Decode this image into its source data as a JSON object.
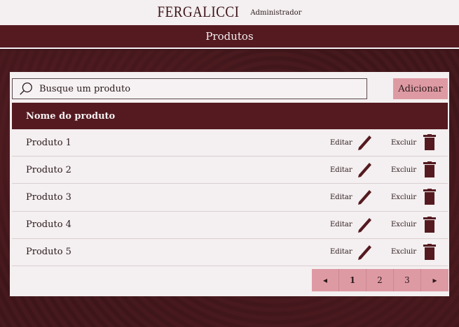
{
  "header": {
    "brand": "FERGALICCI",
    "role": "Administrador"
  },
  "title": "Produtos",
  "search": {
    "placeholder": "Busque um produto",
    "icon": "search-icon"
  },
  "add_label": "Adicionar",
  "table": {
    "column": "Nome do produto",
    "rows": [
      {
        "name": "Produto 1",
        "edit": "Editar",
        "delete": "Excluir"
      },
      {
        "name": "Produto 2",
        "edit": "Editar",
        "delete": "Excluir"
      },
      {
        "name": "Produto 3",
        "edit": "Editar",
        "delete": "Excluir"
      },
      {
        "name": "Produto 4",
        "edit": "Editar",
        "delete": "Excluir"
      },
      {
        "name": "Produto 5",
        "edit": "Editar",
        "delete": "Excluir"
      }
    ]
  },
  "pagination": {
    "prev": "◂",
    "pages": [
      "1",
      "2",
      "3"
    ],
    "current": "1",
    "next": "▸"
  },
  "colors": {
    "primary": "#541a20",
    "accent": "#de9aa3",
    "surface": "#f4eff0"
  }
}
